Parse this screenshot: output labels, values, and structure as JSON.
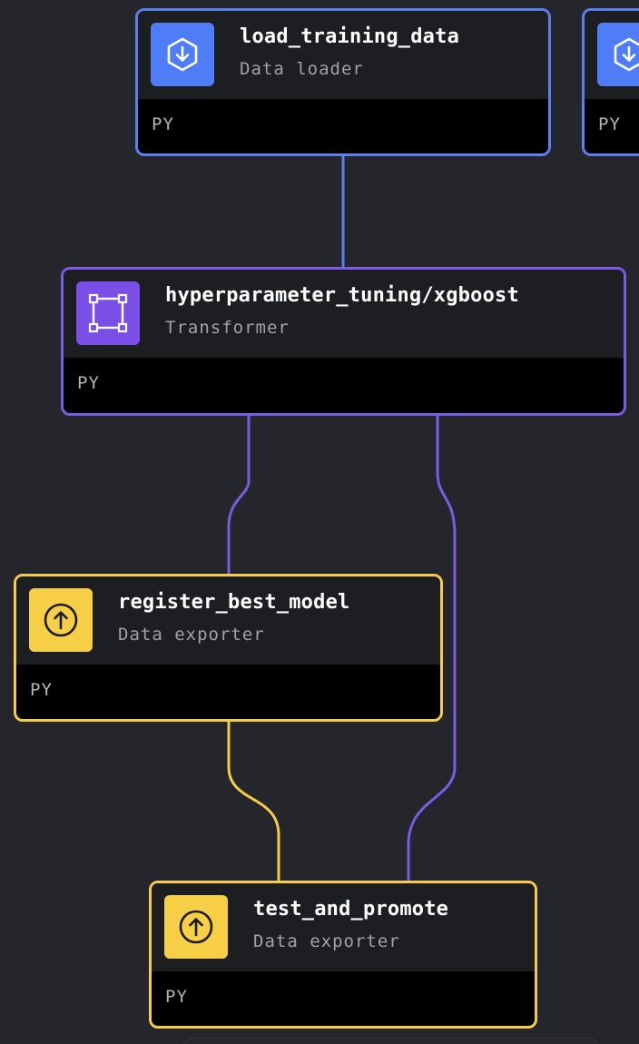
{
  "canvas": {
    "background": "#25262b"
  },
  "colors": {
    "data_loader": "#4f7df7",
    "transformer": "#7a4fe8",
    "data_exporter": "#f7cf47",
    "edge_transformer": "#7b5be6",
    "edge_exporter": "#f4cc48"
  },
  "blocks": {
    "load_training_data": {
      "name": "load_training_data",
      "type": "Data loader",
      "language": "PY",
      "icon": "download-icon"
    },
    "load_partial": {
      "name": "",
      "type": "",
      "language": "PY",
      "icon": "download-icon"
    },
    "hyperparameter_tuning": {
      "name": "hyperparameter_tuning/xgboost",
      "type": "Transformer",
      "language": "PY",
      "icon": "transform-square-icon"
    },
    "register_best_model": {
      "name": "register_best_model",
      "type": "Data exporter",
      "language": "PY",
      "icon": "upload-icon"
    },
    "test_and_promote": {
      "name": "test_and_promote",
      "type": "Data exporter",
      "language": "PY",
      "icon": "upload-icon"
    }
  }
}
